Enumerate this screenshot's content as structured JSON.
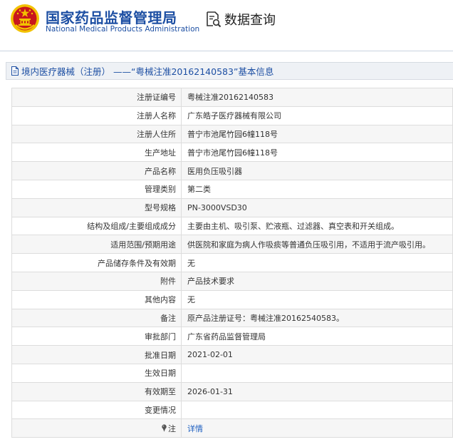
{
  "header": {
    "brand_cn": "国家药品监督管理局",
    "brand_en": "National Medical Products Administration",
    "query_label": "数据查询",
    "colors": {
      "brand_blue": "#1d4fa3",
      "emblem_red": "#c8161d",
      "emblem_gold": "#f2c200"
    }
  },
  "record": {
    "title": "境内医疗器械（注册） ——“粤械注准20162140583”基本信息",
    "rows": [
      {
        "label": "注册证编号",
        "value": "粤械注准20162140583"
      },
      {
        "label": "注册人名称",
        "value": "广东皓子医疗器械有限公司"
      },
      {
        "label": "注册人住所",
        "value": "普宁市池尾竹园6幢118号"
      },
      {
        "label": "生产地址",
        "value": "普宁市池尾竹园6幢118号"
      },
      {
        "label": "产品名称",
        "value": "医用负压吸引器"
      },
      {
        "label": "管理类别",
        "value": "第二类"
      },
      {
        "label": "型号规格",
        "value": "PN-3000VSD30"
      },
      {
        "label": "结构及组成/主要组成成分",
        "value": "主要由主机、吸引泵、贮液瓶、过滤器、真空表和开关组成。"
      },
      {
        "label": "适用范围/预期用途",
        "value": "供医院和家庭为病人作吸痰等普通负压吸引用，不适用于流产吸引用。"
      },
      {
        "label": "产品储存条件及有效期",
        "value": "无"
      },
      {
        "label": "附件",
        "value": "产品技术要求"
      },
      {
        "label": "其他内容",
        "value": "无"
      },
      {
        "label": "备注",
        "value": "原产品注册证号：粤械注准20162540583。"
      },
      {
        "label": "审批部门",
        "value": "广东省药品监督管理局"
      },
      {
        "label": "批准日期",
        "value": "2021-02-01"
      },
      {
        "label": "生效日期",
        "value": ""
      },
      {
        "label": "有效期至",
        "value": "2026-01-31"
      },
      {
        "label": "变更情况",
        "value": ""
      }
    ],
    "note": {
      "label": "注",
      "link_text": "详情",
      "icon": "pin-icon"
    }
  }
}
